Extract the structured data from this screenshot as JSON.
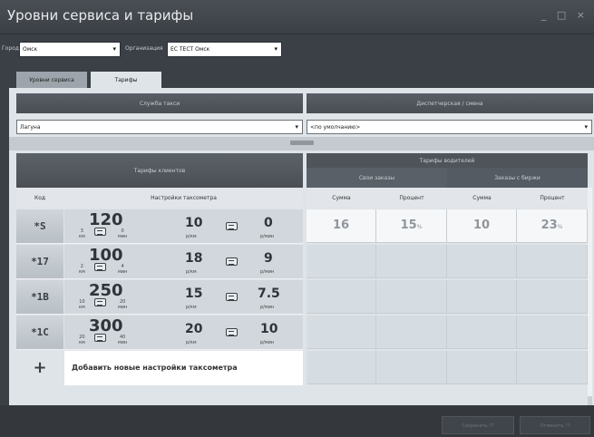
{
  "window": {
    "title": "Уровни сервиса и тарифы",
    "controls": "_ □ ×"
  },
  "filters": {
    "city_label": "Город",
    "city_value": "Омск",
    "org_label": "Организация",
    "org_value": "ЕС ТЕСТ Омск"
  },
  "tabs": [
    {
      "label": "Уровни сервиса"
    },
    {
      "label": "Тарифы"
    }
  ],
  "service": {
    "header": "Служба такси",
    "value": "Лагуна"
  },
  "dispatch": {
    "header": "Диспетчерская / смена",
    "value": "<по умолчанию>"
  },
  "client_tariffs": {
    "header": "Тарифы клиентов",
    "col_code": "Код",
    "col_settings": "Настройки таксометра",
    "rows": [
      {
        "code": "*S",
        "base": "120",
        "km": "3",
        "min": "0",
        "per_km": "10",
        "per_min": "0"
      },
      {
        "code": "*17",
        "base": "100",
        "km": "2",
        "min": "4",
        "per_km": "18",
        "per_min": "9"
      },
      {
        "code": "*1B",
        "base": "250",
        "km": "10",
        "min": "20",
        "per_km": "15",
        "per_min": "7.5"
      },
      {
        "code": "*1C",
        "base": "300",
        "km": "20",
        "min": "40",
        "per_km": "20",
        "per_min": "10"
      }
    ],
    "unit_km": "км",
    "unit_min": "мин",
    "unit_per_km": "р/км",
    "unit_per_min": "р/мин",
    "add_label": "Добавить новые настройки таксометра",
    "add_icon": "+"
  },
  "driver_tariffs": {
    "header": "Тарифы водителей",
    "group_own": "Свои заказы",
    "group_exchange": "Заказы с биржи",
    "col_sum": "Сумма",
    "col_pct": "Процент",
    "rows": [
      {
        "own_sum": "16",
        "own_pct": "15",
        "ex_sum": "10",
        "ex_pct": "23"
      }
    ],
    "pct_sign": "%"
  },
  "buttons": {
    "save": "Сохранить ??",
    "cancel": "Отменить ??"
  },
  "colors": {
    "header": "#4a4f55",
    "panel": "#dfe4e8",
    "row_bg": "#d1d7dc"
  }
}
